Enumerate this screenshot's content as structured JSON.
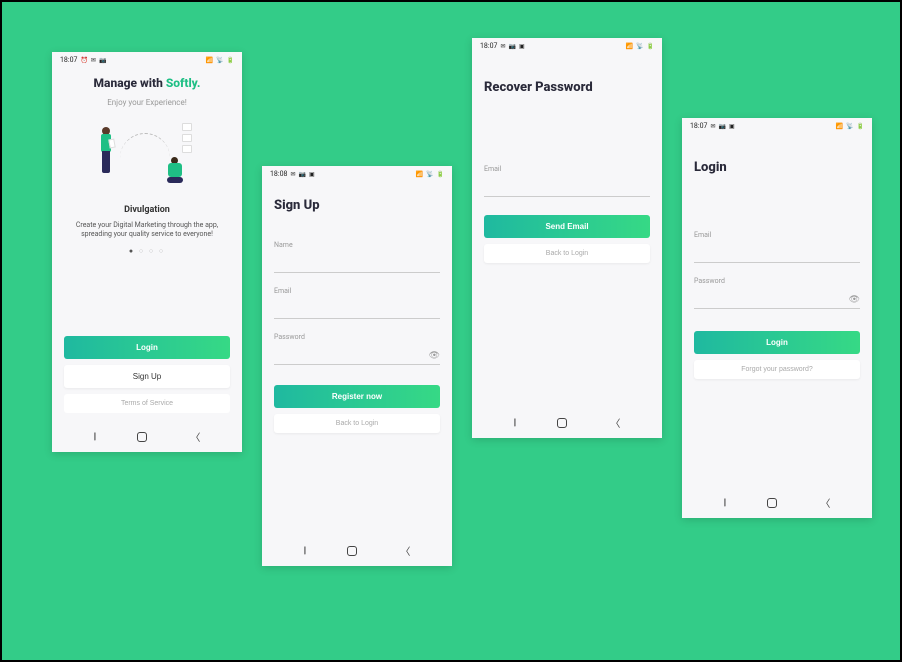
{
  "onboarding": {
    "status_time": "18:07",
    "title_prefix": "Manage with ",
    "title_accent": "Softly.",
    "subtitle": "Enjoy your Experience!",
    "section_title": "Divulgation",
    "description": "Create your Digital Marketing through the app, spreading your quality service to everyone!",
    "login_label": "Login",
    "signup_label": "Sign Up",
    "tos_label": "Terms of Service"
  },
  "signup": {
    "status_time": "18:08",
    "heading": "Sign Up",
    "name_label": "Name",
    "email_label": "Email",
    "password_label": "Password",
    "register_label": "Register now",
    "back_label": "Back to Login"
  },
  "recover": {
    "status_time": "18:07",
    "heading": "Recover Password",
    "email_label": "Email",
    "send_label": "Send Email",
    "back_label": "Back to Login"
  },
  "login": {
    "status_time": "18:07",
    "heading": "Login",
    "email_label": "Email",
    "password_label": "Password",
    "login_label": "Login",
    "forgot_label": "Forgot your password?"
  },
  "status_icons": {
    "right": "ⓘ ⇅ 📶 🔋"
  }
}
